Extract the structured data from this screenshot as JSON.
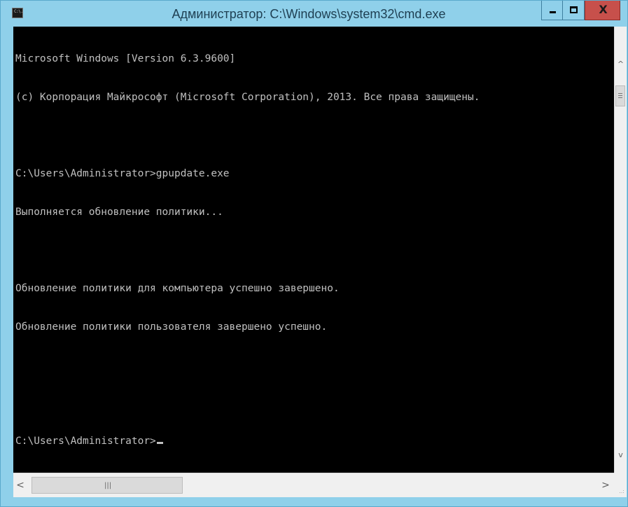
{
  "window": {
    "title": "Администратор: C:\\Windows\\system32\\cmd.exe",
    "icon": "cmd-icon",
    "icon_text": "C:\\.",
    "buttons": {
      "minimize_icon": "minimize-icon",
      "maximize_icon": "maximize-icon",
      "close_icon": "close-icon",
      "close_label": "X"
    }
  },
  "console": {
    "background": "#000000",
    "foreground": "#c0c0c0",
    "lines": [
      "Microsoft Windows [Version 6.3.9600]",
      "(c) Корпорация Майкрософт (Microsoft Corporation), 2013. Все права защищены.",
      "",
      "C:\\Users\\Administrator>gpupdate.exe",
      "Выполняется обновление политики...",
      "",
      "Обновление политики для компьютера успешно завершено.",
      "Обновление политики пользователя завершено успешно.",
      "",
      "",
      "C:\\Users\\Administrator>"
    ]
  },
  "scrollbars": {
    "vertical": {
      "up_glyph": "^",
      "down_glyph": "v",
      "thumb_grip_icon": "grip-icon"
    },
    "horizontal": {
      "left_glyph": "<",
      "right_glyph": ">",
      "thumb_grip": "|||"
    },
    "size_grip": "..:"
  },
  "colors": {
    "frame": "#8fd0ea",
    "close_button": "#c7504b",
    "title_text": "#1e3f52"
  }
}
